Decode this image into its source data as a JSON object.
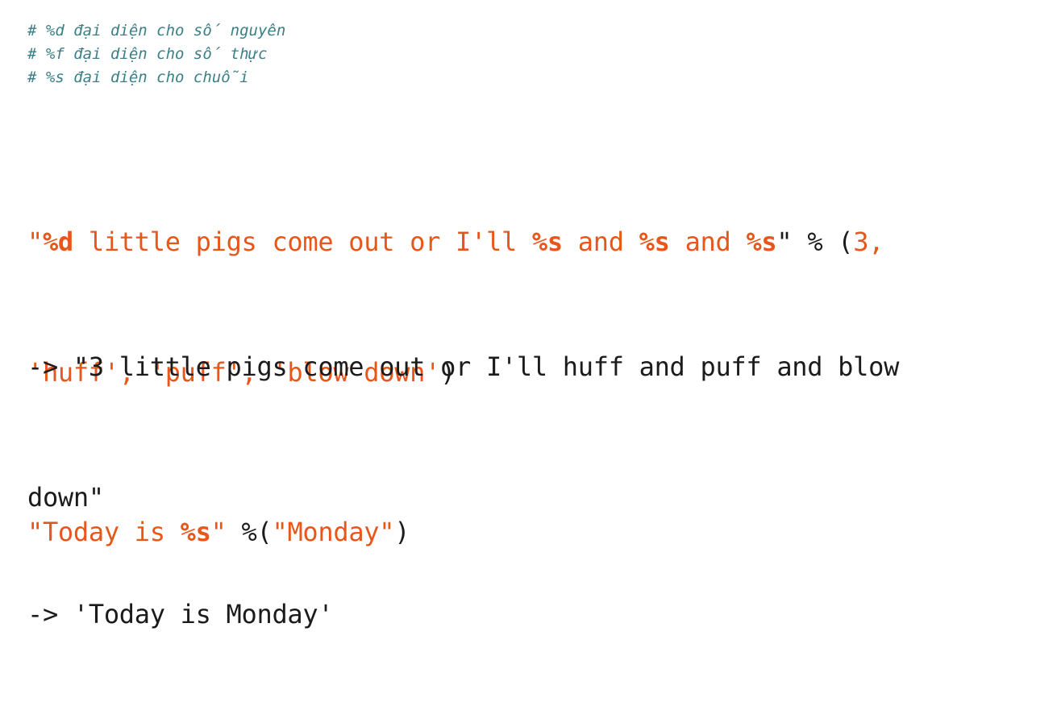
{
  "comments": [
    "# %d đại diện cho số nguyên",
    "# %f đại diện cho số thực",
    "# %s đại diện cho chuỗi"
  ],
  "code1": {
    "line1": {
      "quote_open": "\"",
      "spec_d": "%d",
      "text_a": " little pigs come out or I'll ",
      "spec_s1": "%s",
      "text_b": " and ",
      "spec_s2": "%s",
      "text_c": " and ",
      "spec_s3": "%s",
      "quote_close": "\"",
      "op": " % (",
      "num": "3,"
    },
    "line2": {
      "arg1": "'huff'",
      "sep1": ", ",
      "arg2": "'puff'",
      "sep2": ", ",
      "arg3": "'blow down'",
      "close": ")"
    }
  },
  "output1": {
    "line1": "-> \"3 little pigs come out or I'll huff and puff and blow",
    "line2": "down\""
  },
  "code2": {
    "str_open": "\"Today is ",
    "spec_s": "%s",
    "str_close": "\"",
    "op": " %(",
    "arg": "\"Monday\"",
    "close": ")"
  },
  "output2": {
    "line1": "-> 'Today is Monday'"
  }
}
